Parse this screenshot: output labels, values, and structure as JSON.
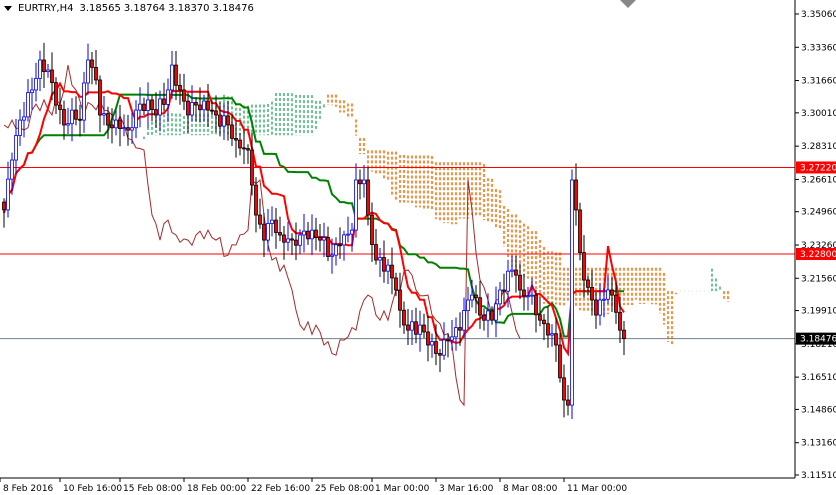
{
  "header": {
    "symbol": "EURTRY,H4",
    "open": "3.18565",
    "high": "3.18764",
    "low": "3.18370",
    "close": "3.18476"
  },
  "chart_data": {
    "type": "candlestick",
    "title": "EURTRY,H4",
    "indicator": "Ichimoku Kinko Hyo (tenkan red, kijun green, chikou brown, cloud dotted)",
    "ylim": [
      3.1151,
      3.3506
    ],
    "y_ticks": [
      "3.35060",
      "3.33360",
      "3.31660",
      "3.30010",
      "3.28310",
      "3.26610",
      "3.24960",
      "3.23260",
      "3.21560",
      "3.19910",
      "3.18210",
      "3.16510",
      "3.14860",
      "3.13160",
      "3.11510"
    ],
    "x_ticks": [
      {
        "bar": 0,
        "label": "8 Feb 2016"
      },
      {
        "bar": 15,
        "label": "10 Feb 16:00"
      },
      {
        "bar": 30,
        "label": "15 Feb 08:00"
      },
      {
        "bar": 46,
        "label": "18 Feb 00:00"
      },
      {
        "bar": 62,
        "label": "22 Feb 16:00"
      },
      {
        "bar": 78,
        "label": "25 Feb 08:00"
      },
      {
        "bar": 93,
        "label": "1 Mar 00:00"
      },
      {
        "bar": 109,
        "label": "3 Mar 16:00"
      },
      {
        "bar": 125,
        "label": "8 Mar 08:00"
      },
      {
        "bar": 141,
        "label": "11 Mar 00:00"
      }
    ],
    "bar_count": 156,
    "close_anchors": [
      [
        0,
        3.2505
      ],
      [
        2,
        3.276
      ],
      [
        4,
        3.2964
      ],
      [
        7,
        3.3118
      ],
      [
        9,
        3.3271
      ],
      [
        11,
        3.322
      ],
      [
        13,
        3.3041
      ],
      [
        15,
        3.2939
      ],
      [
        17,
        3.3015
      ],
      [
        19,
        3.2964
      ],
      [
        21,
        3.3271
      ],
      [
        23,
        3.3169
      ],
      [
        24,
        3.299
      ],
      [
        26,
        3.2939
      ],
      [
        28,
        3.2964
      ],
      [
        31,
        3.2913
      ],
      [
        33,
        3.3015
      ],
      [
        36,
        3.3067
      ],
      [
        38,
        3.299
      ],
      [
        41,
        3.3118
      ],
      [
        42,
        3.3245
      ],
      [
        44,
        3.3118
      ],
      [
        46,
        3.299
      ],
      [
        48,
        3.3041
      ],
      [
        51,
        3.3015
      ],
      [
        53,
        3.299
      ],
      [
        56,
        3.2939
      ],
      [
        58,
        3.2862
      ],
      [
        61,
        3.2811
      ],
      [
        62,
        3.2632
      ],
      [
        63,
        3.2479
      ],
      [
        65,
        3.2351
      ],
      [
        67,
        3.2453
      ],
      [
        69,
        3.2377
      ],
      [
        72,
        3.2351
      ],
      [
        74,
        3.2377
      ],
      [
        77,
        3.2402
      ],
      [
        79,
        3.2351
      ],
      [
        82,
        3.2274
      ],
      [
        84,
        3.2326
      ],
      [
        87,
        3.2402
      ],
      [
        88,
        3.2658
      ],
      [
        90,
        3.2658
      ],
      [
        91,
        3.2479
      ],
      [
        93,
        3.2249
      ],
      [
        96,
        3.2223
      ],
      [
        98,
        3.2096
      ],
      [
        99,
        3.1993
      ],
      [
        101,
        3.1891
      ],
      [
        104,
        3.1917
      ],
      [
        106,
        3.1815
      ],
      [
        109,
        3.1763
      ],
      [
        111,
        3.184
      ],
      [
        114,
        3.1891
      ],
      [
        116,
        3.2045
      ],
      [
        117,
        3.207
      ],
      [
        119,
        3.1968
      ],
      [
        122,
        3.1942
      ],
      [
        124,
        3.2096
      ],
      [
        127,
        3.2198
      ],
      [
        128,
        3.2172
      ],
      [
        129,
        3.2096
      ],
      [
        132,
        3.207
      ],
      [
        134,
        3.1942
      ],
      [
        136,
        3.1866
      ],
      [
        138,
        3.1815
      ],
      [
        140,
        3.1534
      ],
      [
        141,
        3.1508
      ],
      [
        142,
        3.2658
      ],
      [
        143,
        3.2505
      ],
      [
        145,
        3.2147
      ],
      [
        147,
        3.2045
      ],
      [
        148,
        3.1968
      ],
      [
        149,
        3.2045
      ],
      [
        151,
        3.2096
      ],
      [
        152,
        3.207
      ],
      [
        154,
        3.1891
      ],
      [
        155,
        3.18476
      ]
    ],
    "hlines": [
      {
        "price": 3.2722,
        "label": "3.27220",
        "color": "#ff0000"
      },
      {
        "price": 3.228,
        "label": "3.22800",
        "color": "#ff0000"
      },
      {
        "price": 3.18476,
        "label": "3.18476",
        "color": "#708090"
      }
    ],
    "colors": {
      "bull_outline": "#0000ff",
      "bear_body": "#ff0000",
      "bear_outline": "#000000",
      "tenkan": "#ff0000",
      "kijun": "#008000",
      "chikou": "#a52a2a",
      "cloud_bear": "#ff6a00",
      "cloud_bull": "#3cb371"
    }
  }
}
